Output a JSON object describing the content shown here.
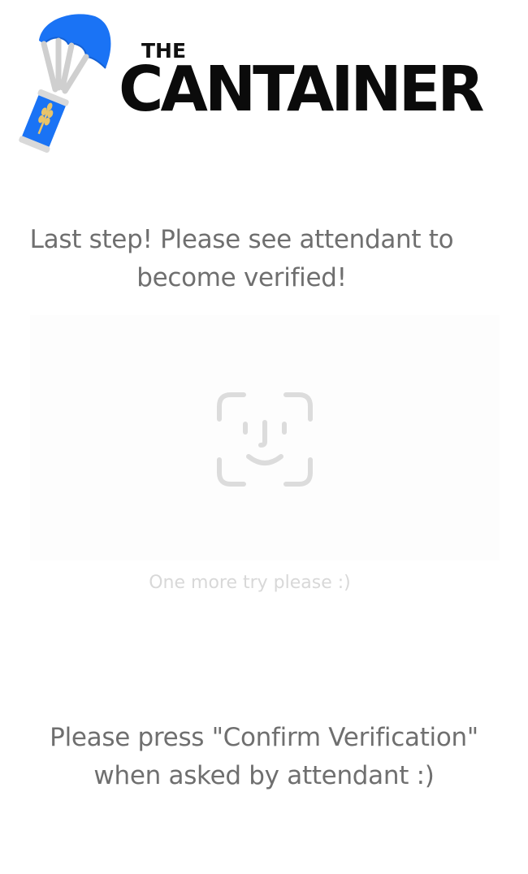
{
  "brand": {
    "top_word": "THE",
    "main_word": "CANTAINER",
    "accent_color": "#1a73f5",
    "text_color": "#0b0b0b",
    "logo_icon": "parachute-can-icon"
  },
  "instruction": {
    "line1": "Last step! Please see attendant to",
    "line2": "become verified!"
  },
  "verification": {
    "icon": "face-id-icon",
    "retry_message": "One more try please :)"
  },
  "footer": {
    "line1": "Please press \"Confirm Verification\"",
    "line2": "when asked by attendant :)"
  },
  "colors": {
    "text_gray": "#6f6f6f",
    "faint_gray": "#d8d8d8",
    "panel_bg": "#fdfdfd"
  }
}
